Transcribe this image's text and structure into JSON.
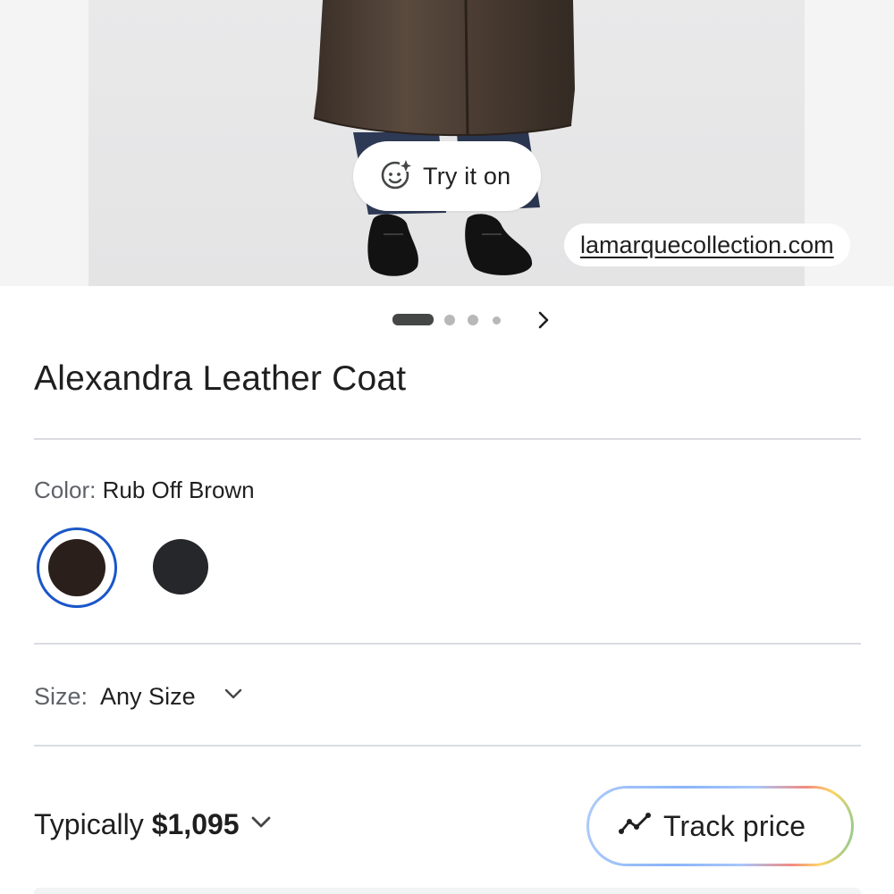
{
  "hero": {
    "try_on_label": "Try it on",
    "try_on_icon": "sparkle-face-icon",
    "source_domain": "lamarquecollection.com"
  },
  "carousel": {
    "total_dots": 4,
    "active_index": 0,
    "next_icon": "chevron-right-icon"
  },
  "product": {
    "title": "Alexandra Leather Coat"
  },
  "color": {
    "label": "Color:",
    "value": "Rub Off Brown",
    "swatches": [
      {
        "color": "#2a1f1b",
        "selected": true
      },
      {
        "color": "#25272a",
        "selected": false
      }
    ],
    "selected_ring_color": "#1a56c9"
  },
  "size": {
    "label": "Size:",
    "value": "Any Size",
    "icon": "chevron-down-icon"
  },
  "price": {
    "label": "Typically",
    "value": "$1,095",
    "icon": "chevron-down-icon"
  },
  "track": {
    "label": "Track price",
    "icon": "trending-line-icon"
  }
}
